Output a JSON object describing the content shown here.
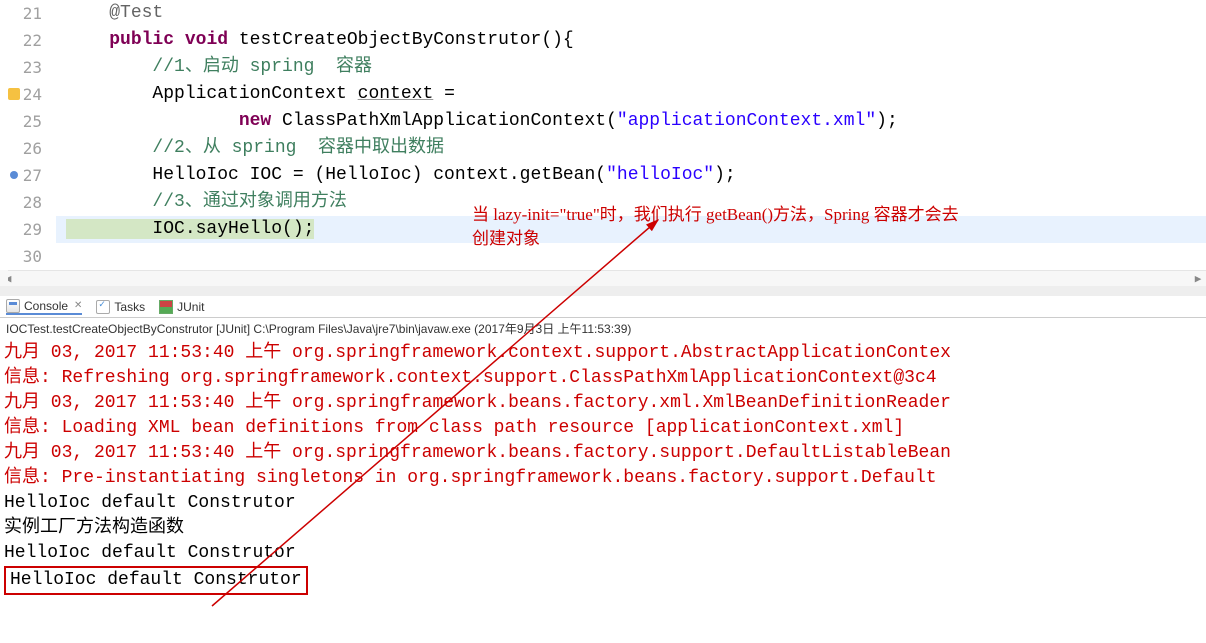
{
  "editor": {
    "lines": [
      {
        "n": 21,
        "html": "    <span class='ann'>@Test</span>"
      },
      {
        "n": 22,
        "html": "    <span class='kw'>public</span> <span class='kw'>void</span> testCreateObjectByConstrutor(){"
      },
      {
        "n": 23,
        "html": "        <span class='com'>//1、启动 spring  容器</span>"
      },
      {
        "n": 24,
        "html": "        ApplicationContext <span class='underline'>context</span> = ",
        "marker": "warn"
      },
      {
        "n": 25,
        "html": "                <span class='kw'>new</span> ClassPathXmlApplicationContext(<span class='str'>\"applicationContext.xml\"</span>);"
      },
      {
        "n": 26,
        "html": "        <span class='com'>//2、从 spring  容器中取出数据</span>"
      },
      {
        "n": 27,
        "html": "        HelloIoc IOC = (HelloIoc) context.getBean(<span class='str'>\"helloIoc\"</span>);",
        "marker": "blue"
      },
      {
        "n": 28,
        "html": "        <span class='com'>//3、通过对象调用方法</span>",
        "edge": "blue"
      },
      {
        "n": 29,
        "html": "        IOC.sayHello();",
        "edge": "blue",
        "exec": true,
        "hl": true
      },
      {
        "n": 30,
        "html": ""
      }
    ]
  },
  "tabs": {
    "console": "Console",
    "tasks": "Tasks",
    "junit": "JUnit"
  },
  "launch": "IOCTest.testCreateObjectByConstrutor [JUnit] C:\\Program Files\\Java\\jre7\\bin\\javaw.exe (2017年9月3日 上午11:53:39)",
  "console": [
    {
      "cls": "err",
      "text": "九月 03, 2017 11:53:40 上午 org.springframework.context.support.AbstractApplicationContex"
    },
    {
      "cls": "err",
      "text": "信息: Refreshing org.springframework.context.support.ClassPathXmlApplicationContext@3c4"
    },
    {
      "cls": "err",
      "text": "九月 03, 2017 11:53:40 上午 org.springframework.beans.factory.xml.XmlBeanDefinitionReader"
    },
    {
      "cls": "err",
      "text": "信息: Loading XML bean definitions from class path resource [applicationContext.xml]"
    },
    {
      "cls": "err",
      "text": "九月 03, 2017 11:53:40 上午 org.springframework.beans.factory.support.DefaultListableBean"
    },
    {
      "cls": "err",
      "text": "信息: Pre-instantiating singletons in org.springframework.beans.factory.support.Default"
    },
    {
      "cls": "std",
      "text": "HelloIoc default Construtor"
    },
    {
      "cls": "std",
      "text": "实例工厂方法构造函数"
    },
    {
      "cls": "std",
      "text": "HelloIoc default Construtor"
    },
    {
      "cls": "std",
      "text": "HelloIoc default Construtor",
      "boxed": true
    }
  ],
  "annotation": {
    "line1": "当 lazy-init=\"true\"时，我们执行 getBean()方法，Spring 容器才会去",
    "line2": "创建对象"
  }
}
